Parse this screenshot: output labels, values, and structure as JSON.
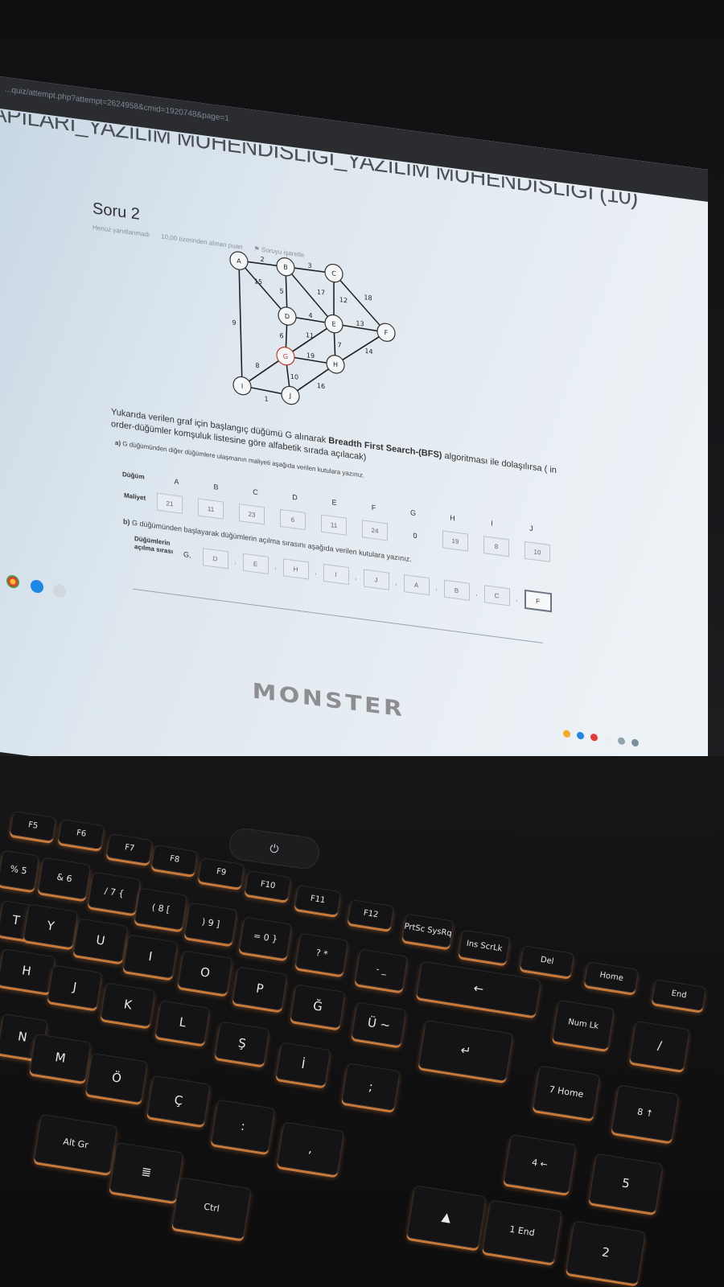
{
  "browser": {
    "url": "...quiz/attempt.php?attempt=2624958&cmid=1920748&page=1"
  },
  "course_title": "APILARI_YAZILIM MÜHENDİSLİĞİ_YAZILIM MÜHENDİSLİĞİ (10)",
  "question": {
    "title": "Soru 2",
    "meta": [
      "Henüz yanıtlanmadı",
      "10,00 üzerinden alınan puan",
      "Soruyu işaretle"
    ],
    "text_before": "Yukarıda verilen graf için başlangıç düğümü G alınarak ",
    "algorithm": "Breadth First Search-(BFS)",
    "text_after": " algoritması ile dolaşılırsa ( in order-düğümler komşuluk listesine göre alfabetik sırada açılacak)",
    "part_a_prefix": "a)",
    "part_a_text": " G düğümünden diğer düğümlere ulaşmanın maliyeti aşağıda verilen kutulara yazınız.",
    "part_b_prefix": "b)",
    "part_b_text": " G düğümünden başlayarak düğümlerin açılma sırasını aşağıda verilen kutulara yazınız.",
    "node_label": "Düğüm",
    "cost_label": "Maliyet",
    "order_label": "Düğümlerin açılma sırası",
    "start_node": "G,",
    "nodes": [
      "A",
      "B",
      "C",
      "D",
      "E",
      "F",
      "G",
      "H",
      "I",
      "J"
    ],
    "costs": [
      "21",
      "11",
      "23",
      "6",
      "11",
      "24",
      "0",
      "19",
      "8",
      "10"
    ],
    "order": [
      "D",
      "E",
      "H",
      "I",
      "J",
      "A",
      "B",
      "C",
      "F"
    ],
    "order_separator": ","
  },
  "graph": {
    "nodes": [
      "A",
      "B",
      "C",
      "D",
      "E",
      "F",
      "G",
      "H",
      "I",
      "J"
    ],
    "edges": [
      {
        "from": "A",
        "to": "B",
        "w": "2"
      },
      {
        "from": "B",
        "to": "C",
        "w": "3"
      },
      {
        "from": "A",
        "to": "D",
        "w": "15"
      },
      {
        "from": "B",
        "to": "D",
        "w": "5"
      },
      {
        "from": "B",
        "to": "E",
        "w": "17"
      },
      {
        "from": "C",
        "to": "E",
        "w": "12"
      },
      {
        "from": "C",
        "to": "F",
        "w": "18"
      },
      {
        "from": "D",
        "to": "E",
        "w": "4"
      },
      {
        "from": "E",
        "to": "F",
        "w": "13"
      },
      {
        "from": "A",
        "to": "I",
        "w": "9"
      },
      {
        "from": "D",
        "to": "G",
        "w": "6"
      },
      {
        "from": "E",
        "to": "G",
        "w": "11"
      },
      {
        "from": "E",
        "to": "H",
        "w": "7"
      },
      {
        "from": "G",
        "to": "H",
        "w": "19"
      },
      {
        "from": "F",
        "to": "H",
        "w": "14"
      },
      {
        "from": "G",
        "to": "I",
        "w": "8"
      },
      {
        "from": "G",
        "to": "J",
        "w": "10"
      },
      {
        "from": "H",
        "to": "J",
        "w": "16"
      },
      {
        "from": "I",
        "to": "J",
        "w": "1"
      }
    ]
  },
  "laptop": {
    "brand": "MONSTER"
  },
  "keyboard": {
    "rows": [
      [
        "F5",
        "F6",
        "F7",
        "F8",
        "F9",
        "F10",
        "F11",
        "F12",
        "PrtSc SysRq",
        "Ins ScrLk",
        "Del",
        "Home",
        "End"
      ],
      [
        "% 5",
        "& 6",
        "/ 7 {",
        "( 8 [",
        ") 9 ]",
        "= 0 }",
        "? *",
        "- _",
        "←"
      ],
      [
        "T",
        "Y",
        "U",
        "I",
        "O",
        "P",
        "Ğ",
        "Ü ~",
        "↵",
        "Num Lk",
        "/"
      ],
      [
        "H",
        "J",
        "K",
        "L",
        "Ş",
        "İ",
        ";",
        "7 Home",
        "8 ↑"
      ],
      [
        "N",
        "M",
        "Ö",
        "Ç",
        ":",
        ",",
        "4 ←",
        "5"
      ],
      [
        "Alt Gr",
        "≣",
        "Ctrl",
        "▲",
        "1 End",
        "2"
      ]
    ]
  },
  "colors": {
    "key_backlight": "#c87a3a",
    "screen_bg": "#e3ebf1",
    "node_highlight": "#c0392b"
  }
}
